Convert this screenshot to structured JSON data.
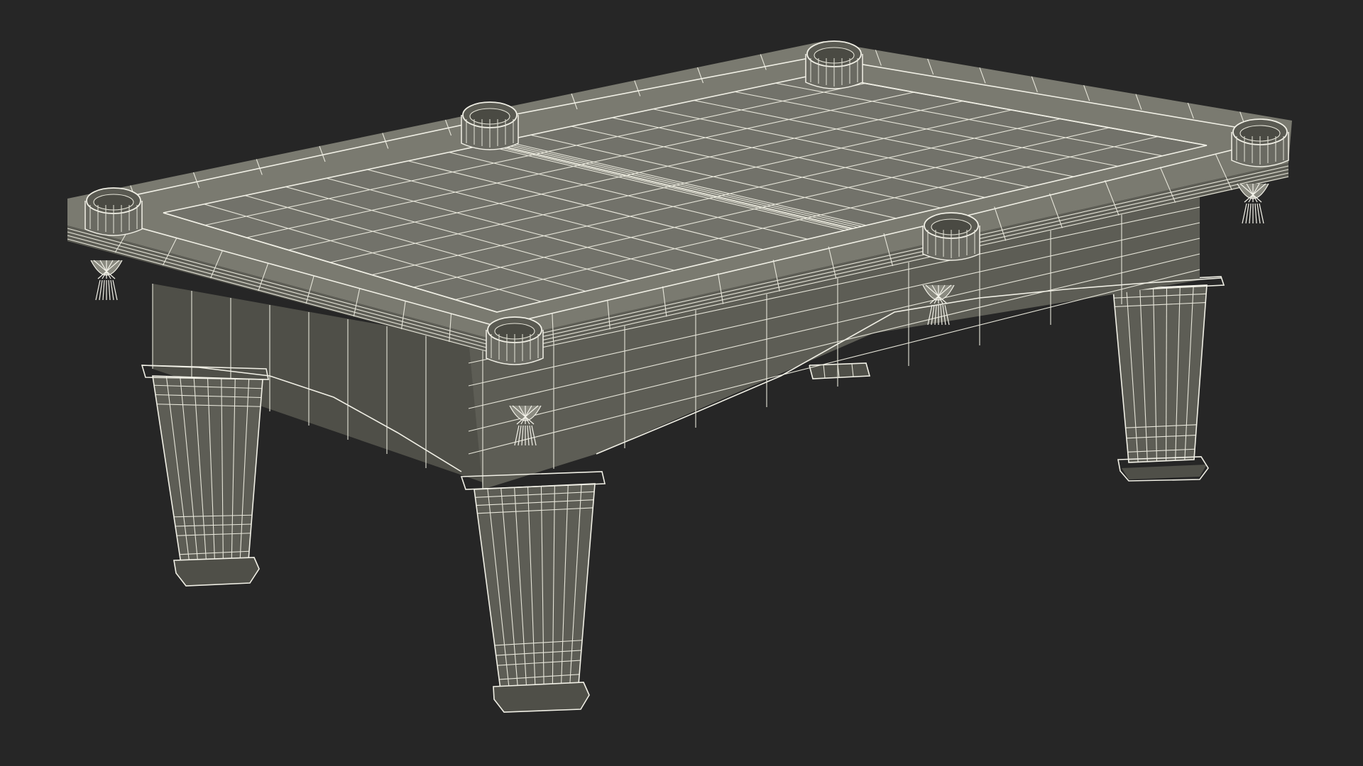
{
  "scene": {
    "subject": "billiard-table",
    "render_style": "wireframe-over-shaded",
    "colors": {
      "background": "#262626",
      "wire": "#ecebdf",
      "surface": "#6f6f66",
      "surface_dark": "#4f4f48"
    },
    "pockets": 6,
    "legs": 4,
    "tassels": 6
  }
}
